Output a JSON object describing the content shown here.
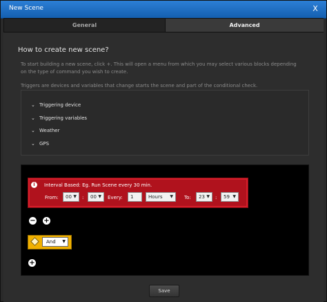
{
  "window": {
    "title": "New Scene",
    "close_glyph": "X"
  },
  "tabs": [
    {
      "label": "General",
      "active": false
    },
    {
      "label": "Advanced",
      "active": true
    }
  ],
  "main": {
    "heading": "How to create new scene?",
    "paragraph1": "To start building a new scene, click +. This will open a menu from which you may select various blocks depending on the type of command you wish to create.",
    "paragraph2": "Triggers are devices and variables that change starts the scene and part of the conditional check.",
    "triggers": [
      {
        "label": "Triggering device"
      },
      {
        "label": "Triggering variables"
      },
      {
        "label": "Weather"
      },
      {
        "label": "GPS"
      }
    ]
  },
  "interval": {
    "title": "Interval Based: Eg. Run Scene every 30 min.",
    "from_label": "From:",
    "from_hour": "00",
    "colon1": ":",
    "from_min": "00",
    "every_label": "Every:",
    "every_value": "1",
    "unit": "Hours",
    "to_label": "To:",
    "to_hour": "23",
    "colon2": ":",
    "to_min": "59"
  },
  "logic": {
    "operator": "And"
  },
  "icons": {
    "info": "i",
    "chevron": "⌄",
    "minus": "−",
    "plus": "+",
    "dropdown": "▼"
  },
  "footer": {
    "save_label": "Save"
  },
  "colors": {
    "titlebar": "#1f6ec5",
    "interval_block": "#b0121d",
    "logic_block": "#f0b000"
  }
}
